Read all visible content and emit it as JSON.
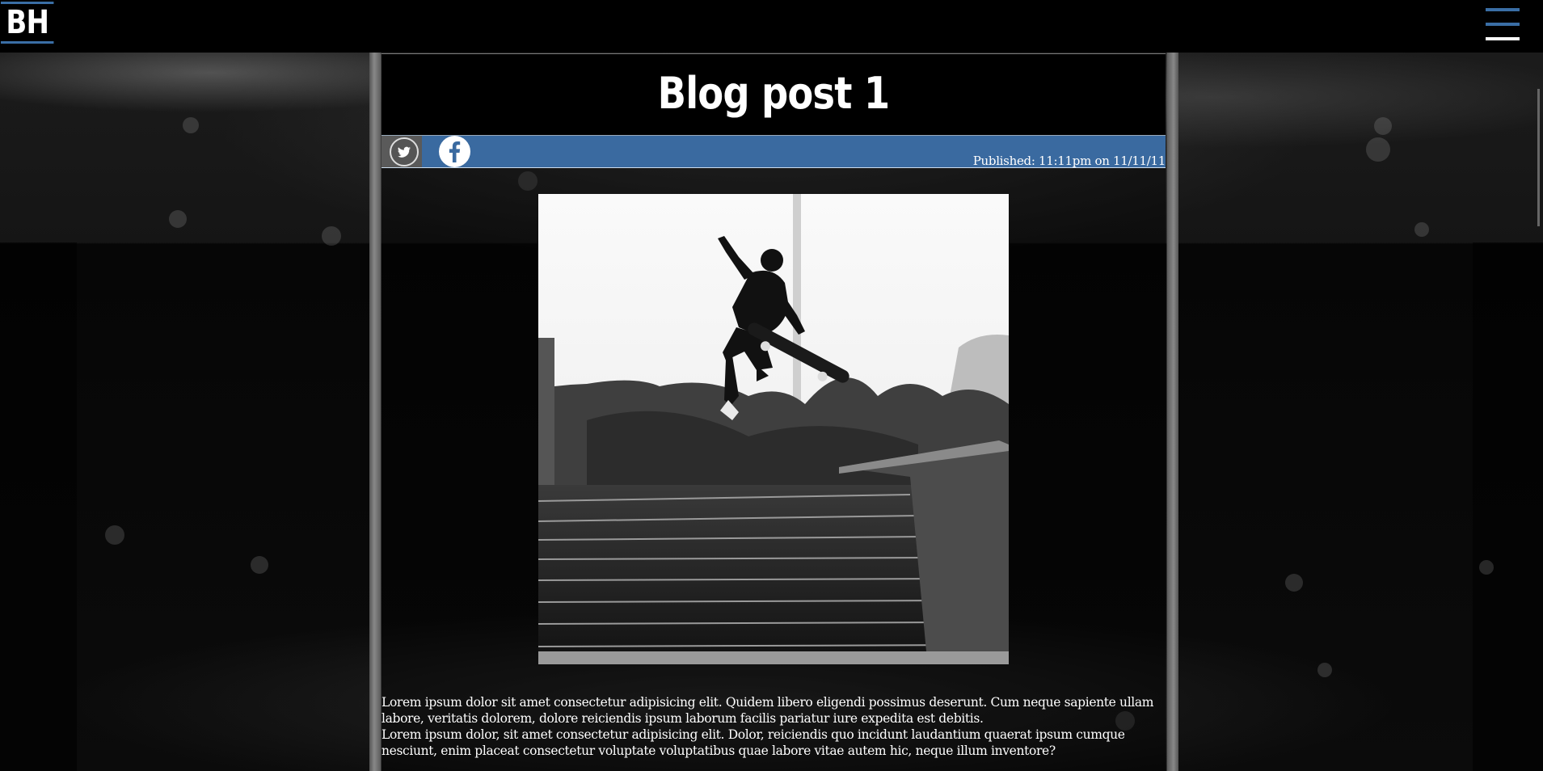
{
  "header": {
    "logo_text": "BH",
    "menu_icon": "hamburger-menu-icon",
    "accent_color": "#3a6ea5"
  },
  "post": {
    "title": "Blog post 1",
    "share": {
      "twitter_icon": "twitter-icon",
      "facebook_icon": "facebook-icon"
    },
    "published": "Published: 11:11pm on 11/11/11",
    "image_alt": "skateboarder-photo",
    "paragraphs": [
      "Lorem ipsum dolor sit amet consectetur adipisicing elit. Quidem libero eligendi possimus deserunt. Cum neque sapiente ullam labore, veritatis dolorem, dolore reiciendis ipsum laborum facilis pariatur iure expedita est debitis.",
      "Lorem ipsum dolor, sit amet consectetur adipisicing elit. Dolor, reiciendis quo incidunt laudantium quaerat ipsum cumque nesciunt, enim placeat consectetur voluptate voluptatibus quae labore vitae autem hic, neque illum inventore?"
    ]
  }
}
